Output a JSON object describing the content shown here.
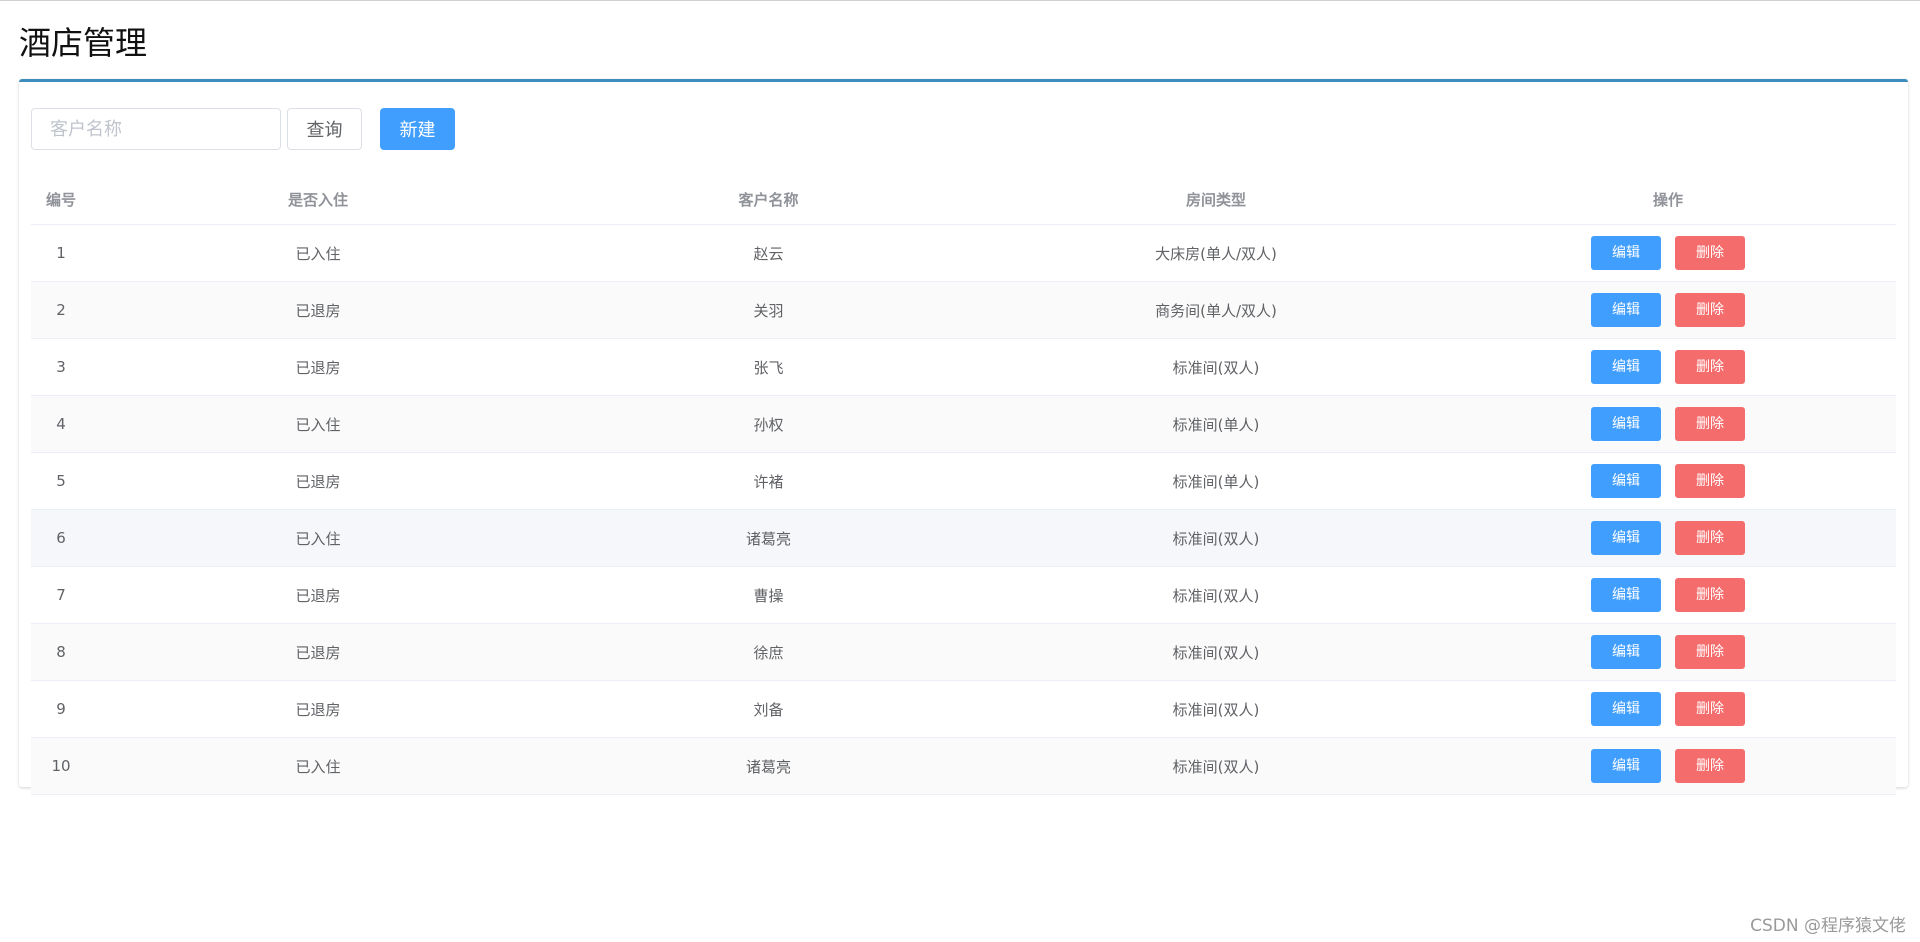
{
  "page": {
    "title": "酒店管理"
  },
  "toolbar": {
    "search_placeholder": "客户名称",
    "query_label": "查询",
    "new_label": "新建"
  },
  "table": {
    "headers": {
      "id": "编号",
      "status": "是否入住",
      "name": "客户名称",
      "room": "房间类型",
      "ops": "操作"
    },
    "edit_label": "编辑",
    "delete_label": "删除",
    "rows": [
      {
        "id": "1",
        "status": "已入住",
        "name": "赵云",
        "room": "大床房(单人/双人)"
      },
      {
        "id": "2",
        "status": "已退房",
        "name": "关羽",
        "room": "商务间(单人/双人)"
      },
      {
        "id": "3",
        "status": "已退房",
        "name": "张飞",
        "room": "标准间(双人)"
      },
      {
        "id": "4",
        "status": "已入住",
        "name": "孙权",
        "room": "标准间(单人)"
      },
      {
        "id": "5",
        "status": "已退房",
        "name": "许褚",
        "room": "标准间(单人)"
      },
      {
        "id": "6",
        "status": "已入住",
        "name": "诸葛亮",
        "room": "标准间(双人)"
      },
      {
        "id": "7",
        "status": "已退房",
        "name": "曹操",
        "room": "标准间(双人)"
      },
      {
        "id": "8",
        "status": "已退房",
        "name": "徐庶",
        "room": "标准间(双人)"
      },
      {
        "id": "9",
        "status": "已退房",
        "name": "刘备",
        "room": "标准间(双人)"
      },
      {
        "id": "10",
        "status": "已入住",
        "name": "诸葛亮",
        "room": "标准间(双人)"
      }
    ]
  },
  "watermark": "CSDN @程序猿文佬",
  "colors": {
    "primary": "#409eff",
    "danger": "#f56c6c",
    "card_border": "#3c8dbc"
  }
}
